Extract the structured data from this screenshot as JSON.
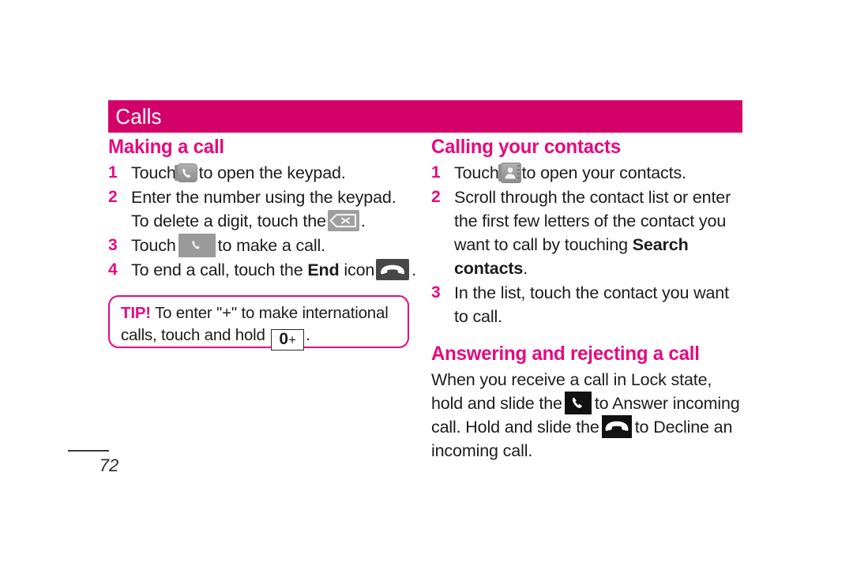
{
  "page": {
    "number": "72",
    "background": "#ffffff",
    "accent_bar_color": "#d4006a",
    "heading_color": "#e5097f"
  },
  "chapter": {
    "title": "Calls"
  },
  "left_column": {
    "section_title": "Making a call",
    "steps": [
      {
        "num": "1",
        "before": "Touch",
        "icon": "phone-keypad-icon",
        "after": "to open the keypad."
      },
      {
        "num": "2",
        "before": "Enter the number using the keypad. To delete a digit, touch the",
        "icon": "backspace-delete-icon",
        "after": "."
      },
      {
        "num": "3",
        "before": "Touch",
        "icon": "call-button-icon",
        "after": "to make a call."
      },
      {
        "num": "4",
        "before": "To end a call, touch the",
        "bold": "End",
        "middle": "icon",
        "icon": "end-call-icon",
        "after": "."
      }
    ],
    "tip": {
      "label": "TIP!",
      "text_before": "To enter \"+\" to make international calls, touch and hold",
      "key_zero": "0",
      "key_plus": "+",
      "text_after": "."
    }
  },
  "right_column": {
    "sections": [
      {
        "title": "Calling your contacts",
        "steps": [
          {
            "num": "1",
            "before": "Touch",
            "icon": "contacts-book-icon",
            "after": "to open your contacts."
          },
          {
            "num": "2",
            "before": "Scroll through the contact list or enter the first few letters of the contact you want to call by touching",
            "bold": "Search contacts",
            "after": "."
          },
          {
            "num": "3",
            "before": "In the list, touch the contact you want to call.",
            "after": ""
          }
        ]
      },
      {
        "title": "Answering and rejecting a call",
        "paragraph": {
          "part1": "When you receive a call in Lock state, hold and slide the",
          "icon1": "answer-call-icon",
          "part2": "to Answer incoming call. Hold and slide the",
          "icon2": "decline-call-icon",
          "part3": "to Decline an incoming call."
        }
      }
    ]
  }
}
